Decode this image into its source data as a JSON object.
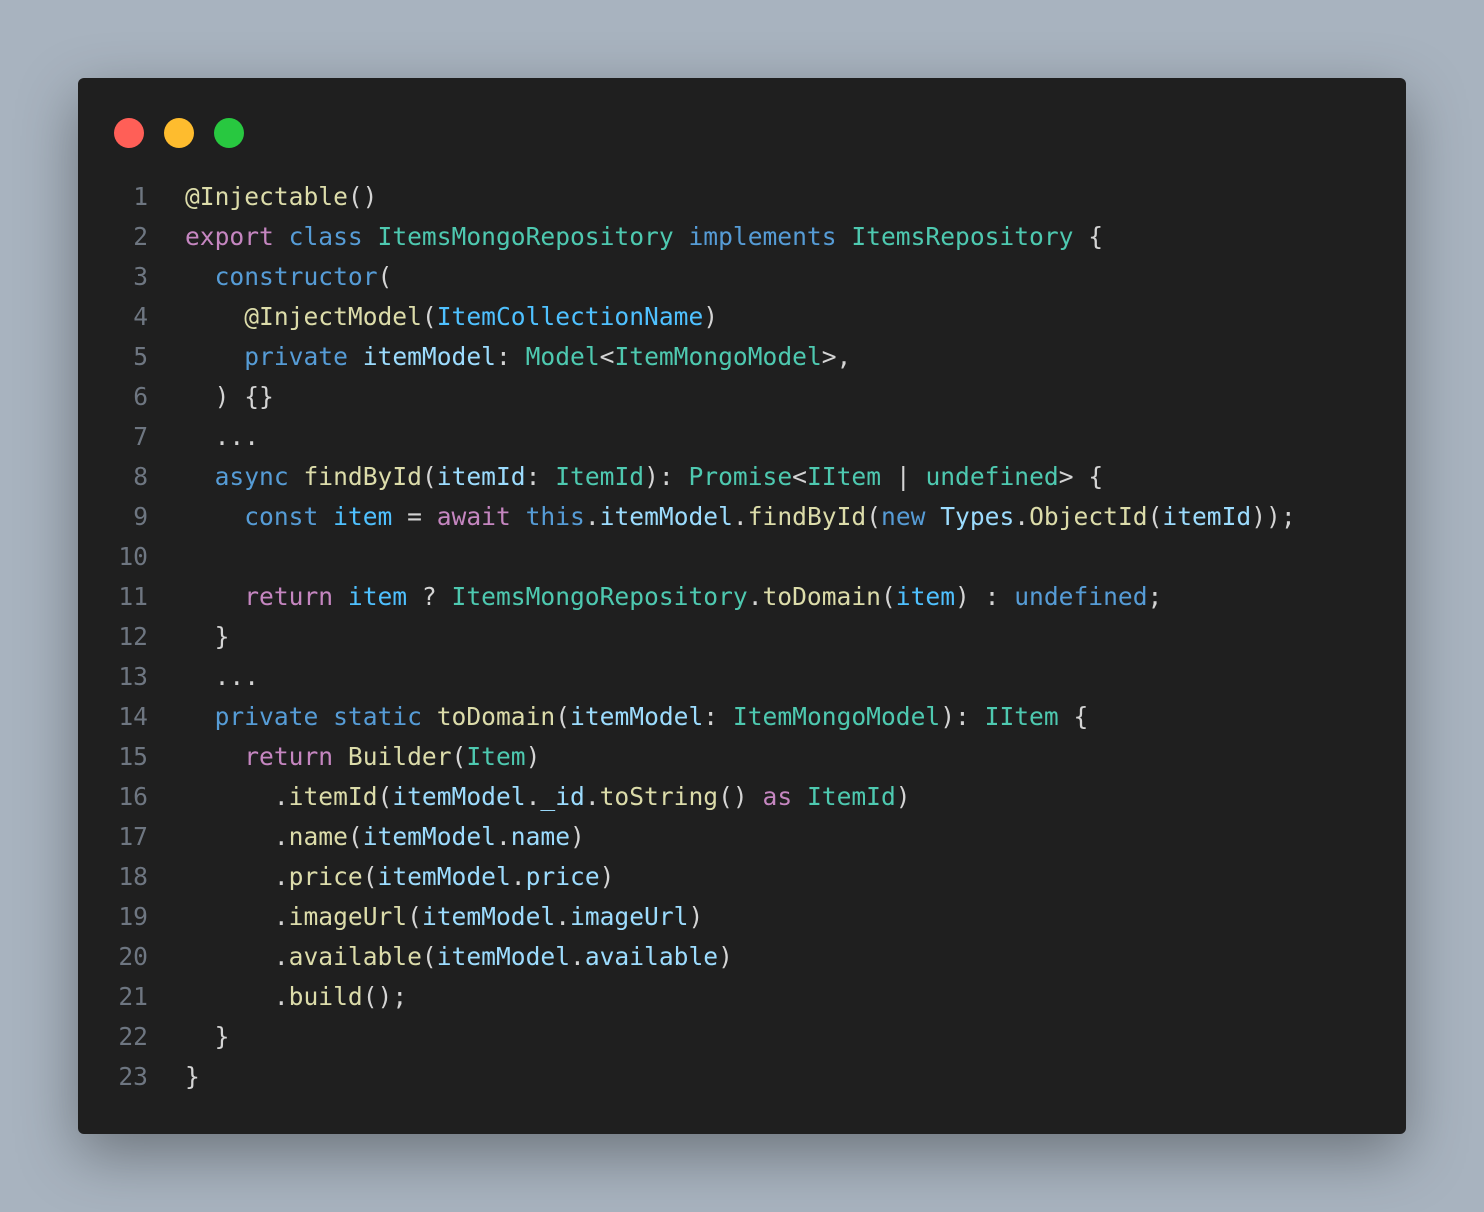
{
  "window": {
    "controls": [
      {
        "name": "close",
        "color": "#ff5f57"
      },
      {
        "name": "minimize",
        "color": "#febc2e"
      },
      {
        "name": "maximize",
        "color": "#28c840"
      }
    ]
  },
  "code": {
    "language": "typescript",
    "lines": [
      {
        "n": "1",
        "tokens": [
          [
            "fn",
            "@Injectable"
          ],
          [
            "plain",
            "()"
          ]
        ]
      },
      {
        "n": "2",
        "tokens": [
          [
            "kw",
            "export"
          ],
          [
            "plain",
            " "
          ],
          [
            "stor",
            "class"
          ],
          [
            "plain",
            " "
          ],
          [
            "type",
            "ItemsMongoRepository"
          ],
          [
            "plain",
            " "
          ],
          [
            "stor",
            "implements"
          ],
          [
            "plain",
            " "
          ],
          [
            "type",
            "ItemsRepository"
          ],
          [
            "plain",
            " {"
          ]
        ]
      },
      {
        "n": "3",
        "tokens": [
          [
            "plain",
            "  "
          ],
          [
            "stor",
            "constructor"
          ],
          [
            "plain",
            "("
          ]
        ]
      },
      {
        "n": "4",
        "tokens": [
          [
            "plain",
            "    "
          ],
          [
            "fn",
            "@InjectModel"
          ],
          [
            "plain",
            "("
          ],
          [
            "const",
            "ItemCollectionName"
          ],
          [
            "plain",
            ")"
          ]
        ]
      },
      {
        "n": "5",
        "tokens": [
          [
            "plain",
            "    "
          ],
          [
            "stor",
            "private"
          ],
          [
            "plain",
            " "
          ],
          [
            "var",
            "itemModel"
          ],
          [
            "plain",
            ": "
          ],
          [
            "type",
            "Model"
          ],
          [
            "plain",
            "<"
          ],
          [
            "type",
            "ItemMongoModel"
          ],
          [
            "plain",
            ">,"
          ]
        ]
      },
      {
        "n": "6",
        "tokens": [
          [
            "plain",
            "  ) {}"
          ]
        ]
      },
      {
        "n": "7",
        "tokens": [
          [
            "plain",
            "  ..."
          ]
        ]
      },
      {
        "n": "8",
        "tokens": [
          [
            "plain",
            "  "
          ],
          [
            "stor",
            "async"
          ],
          [
            "plain",
            " "
          ],
          [
            "fn",
            "findById"
          ],
          [
            "plain",
            "("
          ],
          [
            "var",
            "itemId"
          ],
          [
            "plain",
            ": "
          ],
          [
            "type",
            "ItemId"
          ],
          [
            "plain",
            "): "
          ],
          [
            "type",
            "Promise"
          ],
          [
            "plain",
            "<"
          ],
          [
            "type",
            "IItem"
          ],
          [
            "plain",
            " | "
          ],
          [
            "type",
            "undefined"
          ],
          [
            "plain",
            "> {"
          ]
        ]
      },
      {
        "n": "9",
        "tokens": [
          [
            "plain",
            "    "
          ],
          [
            "stor",
            "const"
          ],
          [
            "plain",
            " "
          ],
          [
            "const",
            "item"
          ],
          [
            "plain",
            " = "
          ],
          [
            "kw",
            "await"
          ],
          [
            "plain",
            " "
          ],
          [
            "stor",
            "this"
          ],
          [
            "plain",
            "."
          ],
          [
            "var",
            "itemModel"
          ],
          [
            "plain",
            "."
          ],
          [
            "fn",
            "findById"
          ],
          [
            "plain",
            "("
          ],
          [
            "stor",
            "new"
          ],
          [
            "plain",
            " "
          ],
          [
            "var",
            "Types"
          ],
          [
            "plain",
            "."
          ],
          [
            "fn",
            "ObjectId"
          ],
          [
            "plain",
            "("
          ],
          [
            "var",
            "itemId"
          ],
          [
            "plain",
            "));"
          ]
        ]
      },
      {
        "n": "10",
        "tokens": []
      },
      {
        "n": "11",
        "tokens": [
          [
            "plain",
            "    "
          ],
          [
            "kw",
            "return"
          ],
          [
            "plain",
            " "
          ],
          [
            "const",
            "item"
          ],
          [
            "plain",
            " ? "
          ],
          [
            "type",
            "ItemsMongoRepository"
          ],
          [
            "plain",
            "."
          ],
          [
            "fn",
            "toDomain"
          ],
          [
            "plain",
            "("
          ],
          [
            "const",
            "item"
          ],
          [
            "plain",
            ") : "
          ],
          [
            "stor",
            "undefined"
          ],
          [
            "plain",
            ";"
          ]
        ]
      },
      {
        "n": "12",
        "tokens": [
          [
            "plain",
            "  }"
          ]
        ]
      },
      {
        "n": "13",
        "tokens": [
          [
            "plain",
            "  ..."
          ]
        ]
      },
      {
        "n": "14",
        "tokens": [
          [
            "plain",
            "  "
          ],
          [
            "stor",
            "private"
          ],
          [
            "plain",
            " "
          ],
          [
            "stor",
            "static"
          ],
          [
            "plain",
            " "
          ],
          [
            "fn",
            "toDomain"
          ],
          [
            "plain",
            "("
          ],
          [
            "var",
            "itemModel"
          ],
          [
            "plain",
            ": "
          ],
          [
            "type",
            "ItemMongoModel"
          ],
          [
            "plain",
            "): "
          ],
          [
            "type",
            "IItem"
          ],
          [
            "plain",
            " {"
          ]
        ]
      },
      {
        "n": "15",
        "tokens": [
          [
            "plain",
            "    "
          ],
          [
            "kw",
            "return"
          ],
          [
            "plain",
            " "
          ],
          [
            "fn",
            "Builder"
          ],
          [
            "plain",
            "("
          ],
          [
            "type",
            "Item"
          ],
          [
            "plain",
            ")"
          ]
        ]
      },
      {
        "n": "16",
        "tokens": [
          [
            "plain",
            "      ."
          ],
          [
            "fn",
            "itemId"
          ],
          [
            "plain",
            "("
          ],
          [
            "var",
            "itemModel"
          ],
          [
            "plain",
            "."
          ],
          [
            "var",
            "_id"
          ],
          [
            "plain",
            "."
          ],
          [
            "fn",
            "toString"
          ],
          [
            "plain",
            "() "
          ],
          [
            "kw",
            "as"
          ],
          [
            "plain",
            " "
          ],
          [
            "type",
            "ItemId"
          ],
          [
            "plain",
            ")"
          ]
        ]
      },
      {
        "n": "17",
        "tokens": [
          [
            "plain",
            "      ."
          ],
          [
            "fn",
            "name"
          ],
          [
            "plain",
            "("
          ],
          [
            "var",
            "itemModel"
          ],
          [
            "plain",
            "."
          ],
          [
            "var",
            "name"
          ],
          [
            "plain",
            ")"
          ]
        ]
      },
      {
        "n": "18",
        "tokens": [
          [
            "plain",
            "      ."
          ],
          [
            "fn",
            "price"
          ],
          [
            "plain",
            "("
          ],
          [
            "var",
            "itemModel"
          ],
          [
            "plain",
            "."
          ],
          [
            "var",
            "price"
          ],
          [
            "plain",
            ")"
          ]
        ]
      },
      {
        "n": "19",
        "tokens": [
          [
            "plain",
            "      ."
          ],
          [
            "fn",
            "imageUrl"
          ],
          [
            "plain",
            "("
          ],
          [
            "var",
            "itemModel"
          ],
          [
            "plain",
            "."
          ],
          [
            "var",
            "imageUrl"
          ],
          [
            "plain",
            ")"
          ]
        ]
      },
      {
        "n": "20",
        "tokens": [
          [
            "plain",
            "      ."
          ],
          [
            "fn",
            "available"
          ],
          [
            "plain",
            "("
          ],
          [
            "var",
            "itemModel"
          ],
          [
            "plain",
            "."
          ],
          [
            "var",
            "available"
          ],
          [
            "plain",
            ")"
          ]
        ]
      },
      {
        "n": "21",
        "tokens": [
          [
            "plain",
            "      ."
          ],
          [
            "fn",
            "build"
          ],
          [
            "plain",
            "();"
          ]
        ]
      },
      {
        "n": "22",
        "tokens": [
          [
            "plain",
            "  }"
          ]
        ]
      },
      {
        "n": "23",
        "tokens": [
          [
            "plain",
            "}"
          ]
        ]
      }
    ]
  }
}
